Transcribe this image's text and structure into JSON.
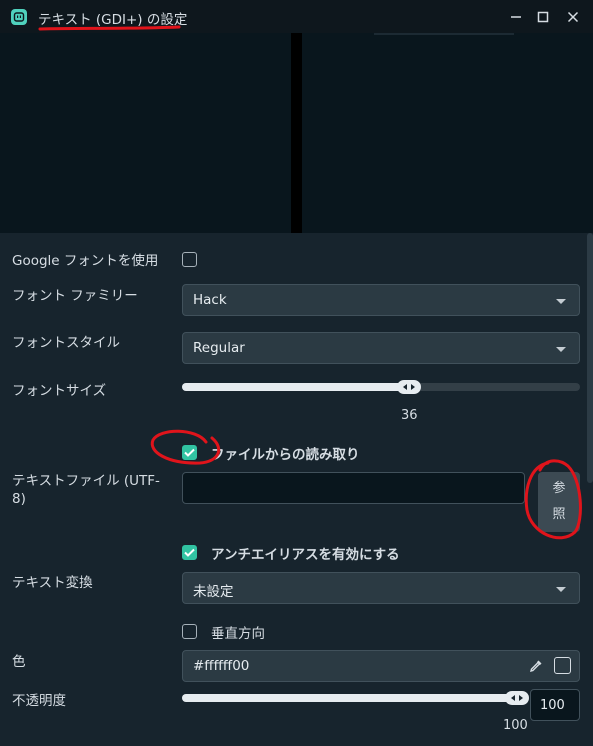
{
  "window": {
    "title": "テキスト (GDI+) の設定",
    "app_icon": "streamlabs-logo-icon",
    "controls": {
      "minimize": "minimize-icon",
      "maximize": "maximize-icon",
      "close": "close-icon"
    }
  },
  "form": {
    "google_fonts": {
      "label": "Google フォントを使用",
      "checked": false
    },
    "font_family": {
      "label": "フォント ファミリー",
      "value": "Hack"
    },
    "font_style": {
      "label": "フォントスタイル",
      "value": "Regular"
    },
    "font_size": {
      "label": "フォントサイズ",
      "value": "36",
      "fraction": 0.57
    },
    "read_from_file": {
      "label": "ファイルからの読み取り",
      "checked": true
    },
    "text_file": {
      "label_line1": "テキストファイル (UTF-",
      "label_line2": "8)",
      "value": "",
      "browse_line1": "参",
      "browse_line2": "照"
    },
    "antialias": {
      "label": "アンチエイリアスを有効にする",
      "checked": true
    },
    "text_transform": {
      "label": "テキスト変換",
      "value": "未設定"
    },
    "vertical": {
      "label": "垂直方向",
      "checked": false
    },
    "color": {
      "label": "色",
      "value": "#ffffff00",
      "picker_icon": "eyedropper-icon"
    },
    "opacity": {
      "label": "不透明度",
      "value": "100",
      "input_value": "100",
      "fraction": 1.0
    }
  },
  "colors": {
    "accent": "#31c3a2",
    "annotation": "#e0141b",
    "background": "#17242d",
    "titlebar": "#0e171d"
  }
}
